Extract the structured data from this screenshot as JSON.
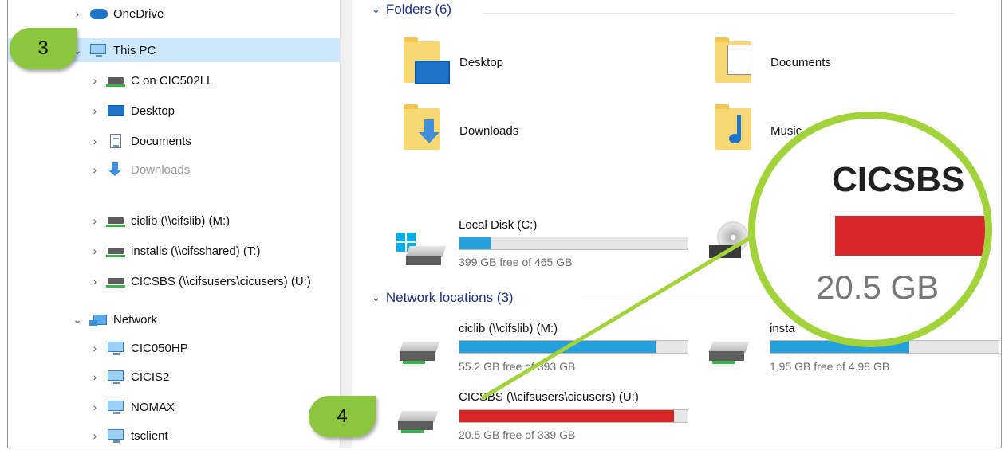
{
  "nav": {
    "items": [
      {
        "label": "OneDrive",
        "icon": "onedrive-icon",
        "chevron": ">"
      },
      {
        "label": "This PC",
        "icon": "computer-icon",
        "chevron": "v"
      },
      {
        "label": "C on CIC502LL",
        "icon": "network-drive-icon",
        "chevron": ">"
      },
      {
        "label": "Desktop",
        "icon": "desktop-icon",
        "chevron": ">"
      },
      {
        "label": "Documents",
        "icon": "documents-icon",
        "chevron": ">"
      },
      {
        "label": "Downloads",
        "icon": "downloads-icon",
        "chevron": ">"
      },
      {
        "label": "ciclib (\\\\cifslib) (M:)",
        "icon": "network-drive-icon",
        "chevron": ">"
      },
      {
        "label": "installs (\\\\cifsshared) (T:)",
        "icon": "network-drive-icon",
        "chevron": ">"
      },
      {
        "label": "CICSBS (\\\\cifsusers\\cicusers) (U:)",
        "icon": "network-drive-icon",
        "chevron": ">"
      },
      {
        "label": "Network",
        "icon": "network-icon",
        "chevron": "v"
      },
      {
        "label": "CIC050HP",
        "icon": "computer-icon",
        "chevron": ">"
      },
      {
        "label": "CICIS2",
        "icon": "computer-icon",
        "chevron": ">"
      },
      {
        "label": "NOMAX",
        "icon": "computer-icon",
        "chevron": ">"
      },
      {
        "label": "tsclient",
        "icon": "computer-icon",
        "chevron": ">"
      }
    ]
  },
  "main": {
    "folders_header": "Folders (6)",
    "folders": [
      "Desktop",
      "Documents",
      "Downloads",
      "Music"
    ],
    "network_header": "Network locations (3)",
    "drives": [
      {
        "name": "Local Disk (C:)",
        "free": "399 GB free of 465 GB",
        "used_fraction": 0.14,
        "color": "#26a0da"
      },
      {
        "name": "ciclib (\\\\cifslib) (M:)",
        "free": "55.2 GB free of 393 GB",
        "used_fraction": 0.86,
        "color": "#26a0da"
      },
      {
        "name": "insta",
        "free": "1.95 GB free of 4.98 GB",
        "used_fraction": 0.61,
        "color": "#26a0da"
      },
      {
        "name": "CICSBS (\\\\cifsusers\\cicusers) (U:)",
        "free": "20.5 GB free of 339 GB",
        "used_fraction": 0.94,
        "color": "#da2626"
      }
    ]
  },
  "callouts": {
    "step3": "3",
    "step4": "4"
  },
  "zoom": {
    "title": "CICSBS",
    "free": "20.5 GB"
  },
  "colors": {
    "accent": "#8cc63f",
    "selection": "#cce8ff",
    "bar_normal": "#26a0da",
    "bar_full": "#da2626"
  }
}
